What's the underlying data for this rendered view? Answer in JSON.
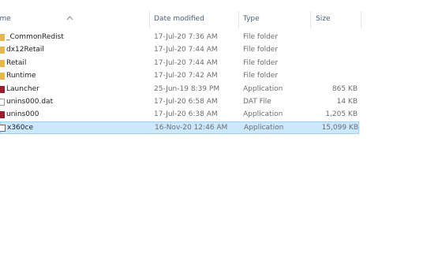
{
  "columns": {
    "name": "ame",
    "date": "Date modified",
    "type": "Type",
    "size": "Size"
  },
  "sort": {
    "column": "name",
    "direction": "ascending",
    "icon": "sort-up-arrow-icon"
  },
  "files": [
    {
      "name": "_CommonRedist",
      "date": "17-Jul-20 7:36 AM",
      "type": "File folder",
      "size": "",
      "icon": "folder-icon",
      "selected": false
    },
    {
      "name": "dx12Retail",
      "date": "17-Jul-20 7:44 AM",
      "type": "File folder",
      "size": "",
      "icon": "folder-icon",
      "selected": false
    },
    {
      "name": "Retail",
      "date": "17-Jul-20 7:44 AM",
      "type": "File folder",
      "size": "",
      "icon": "folder-icon",
      "selected": false
    },
    {
      "name": "Runtime",
      "date": "17-Jul-20 7:42 AM",
      "type": "File folder",
      "size": "",
      "icon": "folder-icon",
      "selected": false
    },
    {
      "name": "Launcher",
      "date": "25-Jun-19 8:39 PM",
      "type": "Application",
      "size": "865 KB",
      "icon": "app-icon",
      "selected": false
    },
    {
      "name": "unins000.dat",
      "date": "17-Jul-20 6:58 AM",
      "type": "DAT File",
      "size": "14 KB",
      "icon": "file-icon",
      "selected": false
    },
    {
      "name": "unins000",
      "date": "17-Jul-20 6:38 AM",
      "type": "Application",
      "size": "1,205 KB",
      "icon": "installer-icon",
      "selected": false
    },
    {
      "name": "x360ce",
      "date": "16-Nov-20 12:46 AM",
      "type": "Application",
      "size": "15,099 KB",
      "icon": "gamepad-app-icon",
      "selected": true
    }
  ],
  "colors": {
    "selection": "#cce8ff",
    "selection_border": "#99d1ff",
    "header_text": "#4c607a"
  }
}
